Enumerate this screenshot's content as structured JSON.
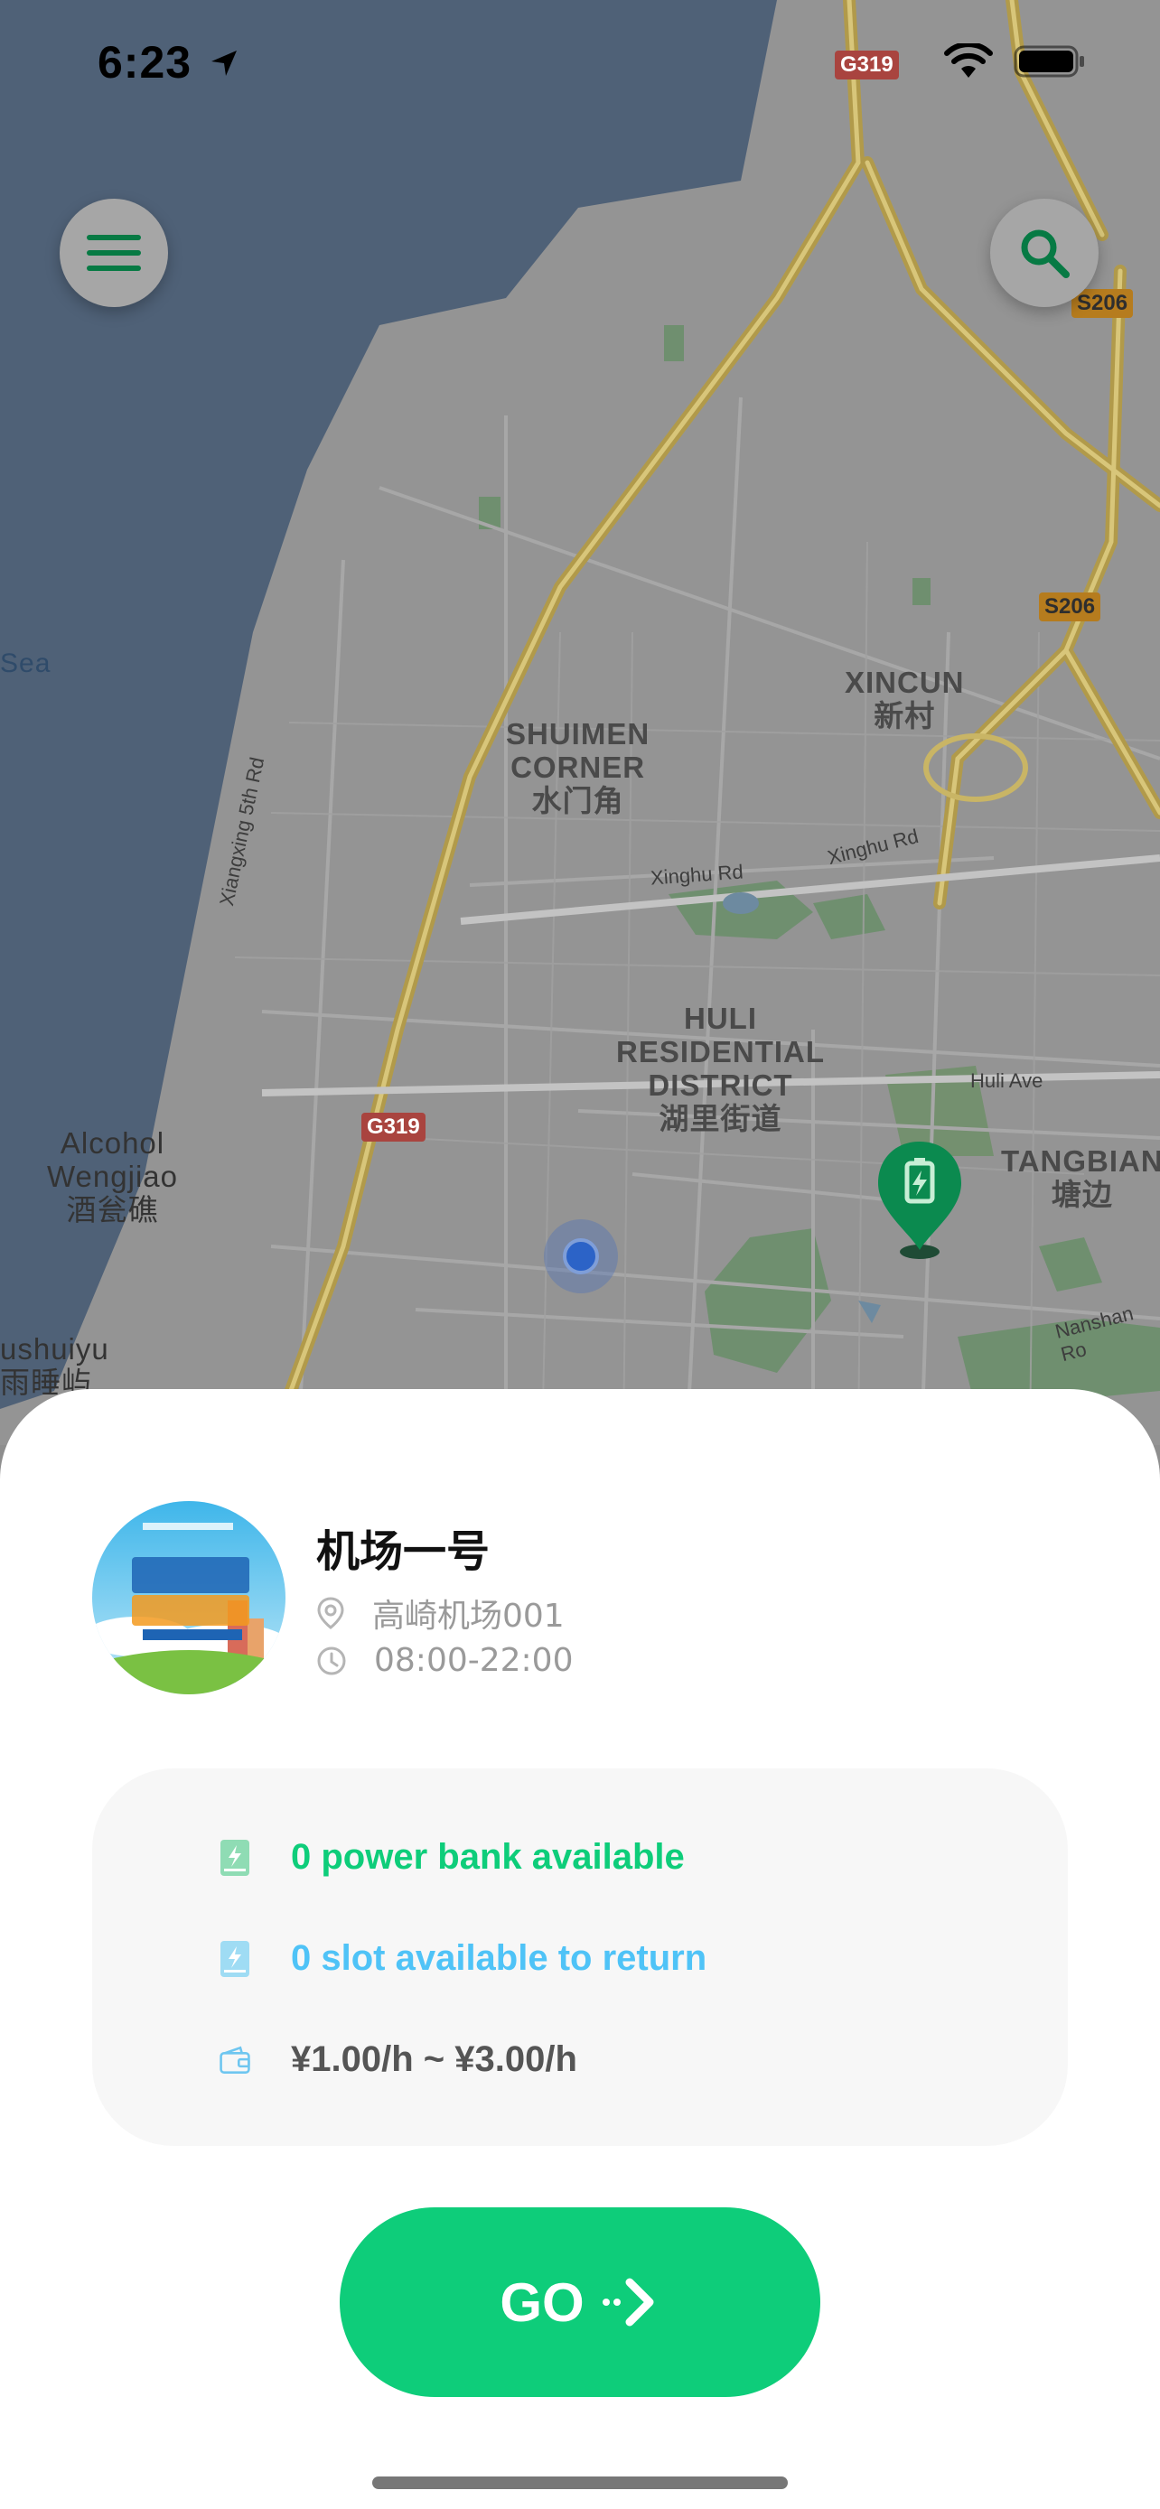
{
  "status_bar": {
    "time": "6:23"
  },
  "map": {
    "places": {
      "shuimen": "SHUIMEN\nCORNER\n水门角",
      "xincun": "XINCUN\n新村",
      "huli": "HULI\nRESIDENTIAL\nDISTRICT\n湖里街道",
      "tangbian": "TANGBIAN\n塘边",
      "alcohol": "Alcohol\nWengjiao\n酒瓮礁",
      "sea": "Sea",
      "shuiyu": "ushuiyu\n雨睡屿"
    },
    "roads": {
      "xinghu1": "Xinghu Rd",
      "xinghu2": "Xinghu Rd",
      "xiangxing": "Xiangxing 5th Rd",
      "huli_ave": "Huli Ave",
      "nanshan": "Nanshan Ro"
    },
    "shields": {
      "g319_top": "G319",
      "g319_mid": "G319",
      "s206_top": "S206",
      "s206_mid": "S206"
    }
  },
  "station": {
    "name": "机场一号",
    "address": "高崎机场001",
    "hours": "08:00-22:00"
  },
  "stats": {
    "power_banks": "0 power bank available",
    "slots": "0 slot available to return",
    "price": "¥1.00/h ~ ¥3.00/h"
  },
  "go_label": "GO",
  "colors": {
    "accent": "#0ecd7a",
    "slot_blue": "#4fc3f7",
    "pin_green": "#0b8a4f"
  }
}
